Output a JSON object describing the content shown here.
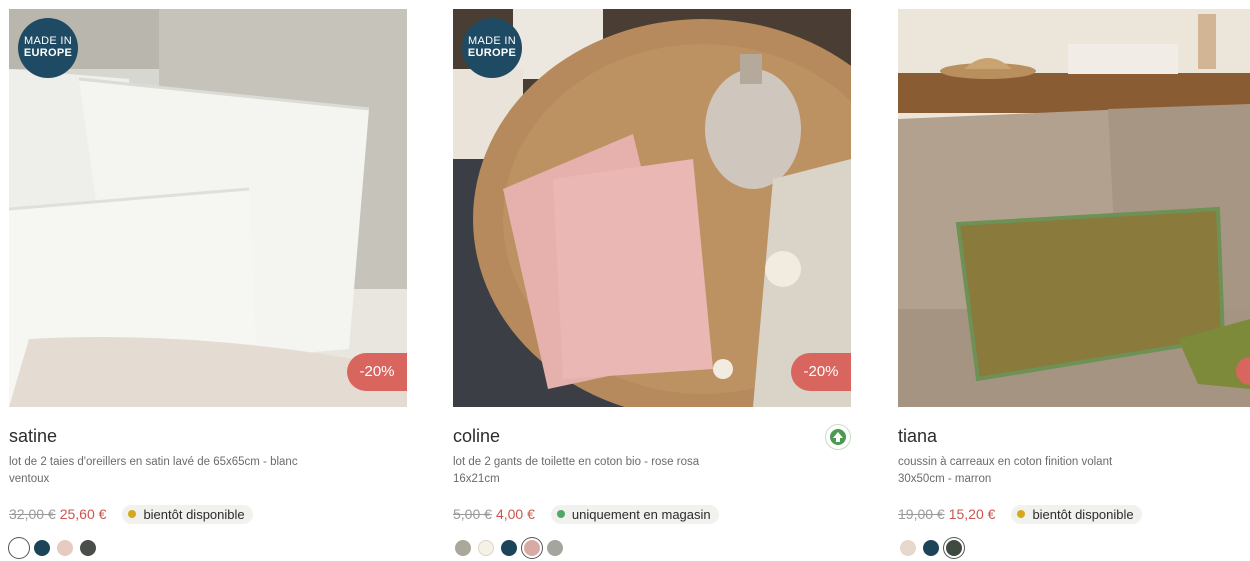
{
  "products": [
    {
      "badge": {
        "line1": "MADE IN",
        "line2": "EUROPE"
      },
      "discount": "-20%",
      "name": "satine",
      "description": "lot de 2 taies d'oreillers en satin lavé de 65x65cm - blanc ventoux",
      "old_price": "32,00 €",
      "price": "25,60 €",
      "availability": "bientôt disponible",
      "availability_color": "#d6a81e",
      "swatches": [
        "#ffffff",
        "#1c4459",
        "#e5cbc0",
        "#4a4e4b"
      ],
      "selected_swatch": 0
    },
    {
      "badge": {
        "line1": "MADE IN",
        "line2": "EUROPE"
      },
      "discount": "-20%",
      "name": "coline",
      "description": "lot de 2 gants de toilette en coton bio - rose rosa 16x21cm",
      "old_price": "5,00 €",
      "price": "4,00 €",
      "availability": "uniquement en magasin",
      "availability_color": "#4fa866",
      "organic_icon": "organic-cotton-icon",
      "swatches": [
        "#a9a89a",
        "#f6f1e6",
        "#1c4459",
        "#d7aaa5",
        "#a4a59c"
      ],
      "selected_swatch": 3
    },
    {
      "name": "tiana",
      "description": "coussin à carreaux en coton finition volant 30x50cm - marron",
      "old_price": "19,00 €",
      "price": "15,20 €",
      "availability": "bientôt disponible",
      "availability_color": "#d6a81e",
      "swatches": [
        "#e6d8cc",
        "#1c4459",
        "#3f4a40"
      ],
      "selected_swatch": 2
    }
  ],
  "colors": {
    "accent_red": "#c9574f",
    "discount_bg": "#d8665e",
    "badge_blue": "#1f4a63"
  }
}
